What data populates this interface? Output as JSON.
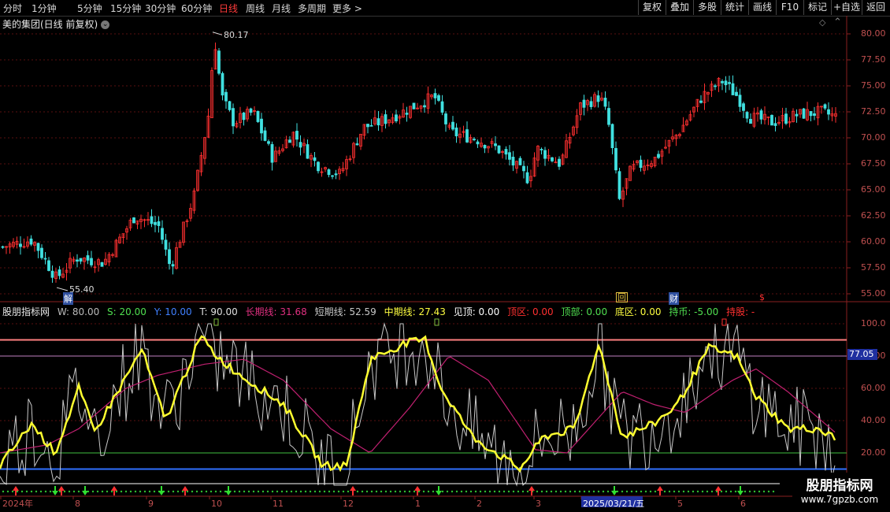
{
  "periods": [
    {
      "label": "分时",
      "active": false
    },
    {
      "label": "1分钟",
      "active": false
    },
    {
      "label": "5分钟",
      "active": false
    },
    {
      "label": "15分钟",
      "active": false
    },
    {
      "label": "30分钟",
      "active": false
    },
    {
      "label": "60分钟",
      "active": false
    },
    {
      "label": "日线",
      "active": true
    },
    {
      "label": "周线",
      "active": false
    },
    {
      "label": "月线",
      "active": false
    },
    {
      "label": "多周期",
      "active": false
    },
    {
      "label": "更多 >",
      "active": false
    }
  ],
  "tools": [
    "复权",
    "叠加",
    "多股",
    "统计",
    "画线",
    "F10",
    "标记",
    "+自选",
    "返回"
  ],
  "stock_title": "美的集团(日线 前复权)",
  "price_axis": [
    "80.00",
    "77.50",
    "75.00",
    "72.50",
    "70.00",
    "67.50",
    "65.00",
    "62.50",
    "60.00",
    "57.50",
    "55.00"
  ],
  "high_label": "80.17",
  "low_label": "55.40",
  "event_markers": {
    "jie": "解",
    "hui": "回",
    "cai": "财",
    "s": "$"
  },
  "indicator_values": {
    "name": "股朋指标网",
    "w": "W: 80.00",
    "s": "S: 20.00",
    "y": "Y: 10.00",
    "t": "T: 90.00",
    "long": "长期线: 31.68",
    "short": "短期线: 52.59",
    "mid": "中期线: 27.43",
    "jianding": "见顶: 0.00",
    "dingqu": "顶区: 0.00",
    "dingbu": "顶部: 0.00",
    "diqu": "底区: 0.00",
    "chibi": "持币: -5.00",
    "chigu": "持股: -"
  },
  "ind_axis": [
    "100.0",
    "80.00",
    "60.00",
    "40.00",
    "20.00"
  ],
  "current_value": "77.05",
  "date_axis": [
    "2024年",
    "8",
    "9",
    "10",
    "11",
    "12",
    "1",
    "2",
    "3",
    "2025/03/21/五",
    "5",
    "6"
  ],
  "brand": {
    "name": "股朋指标网",
    "url": "www.7gpzb.com"
  },
  "colors": {
    "up": "#ff3030",
    "down": "#40e0e0",
    "long": "#c02070",
    "mid": "#ffff30",
    "short": "#c8c8c8"
  }
}
